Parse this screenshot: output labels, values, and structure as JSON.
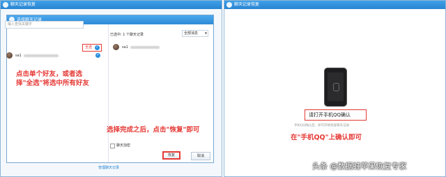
{
  "left_window": {
    "title": "聊天记录恢复",
    "controls": [
      "–",
      "×"
    ]
  },
  "dialog": {
    "title": "选择聊天记录",
    "search_placeholder": "输入查找关键字",
    "select_all_label": "全选",
    "friend_name_prefix": "sa1",
    "selected_count": "已选中: 1 个聊天记录",
    "message_filter": "全部消息",
    "selected_friend_prefix": "sa1",
    "encrypt_label": "聊天加密",
    "restore_label": "恢复",
    "cancel_label": "取消",
    "footer_link": "管理聊天记录"
  },
  "annotations": {
    "select_tip_line1": "点击单个好友，或者选",
    "select_tip_line2": "择\"全选\"将选中所有好友",
    "restore_tip": "选择完成之后，点击\"恢复\"即可",
    "confirm_tip": "在\"手机QQ\"上确认即可"
  },
  "right_window": {
    "title": "聊天记录恢复",
    "controls": [
      "×"
    ],
    "phone_prompt": "请打开手机QQ确认",
    "sub_hint": "手机QQ确认后，即可开始恢复聊天记录"
  },
  "watermark": "头条 @数据蛙苹果恢复专家",
  "colors": {
    "accent_blue": "#2a84d2",
    "highlight_red": "#e53935"
  },
  "icons": [
    "qq-penguin-icon",
    "check-circle-icon",
    "phone-icon",
    "lock-icon"
  ]
}
